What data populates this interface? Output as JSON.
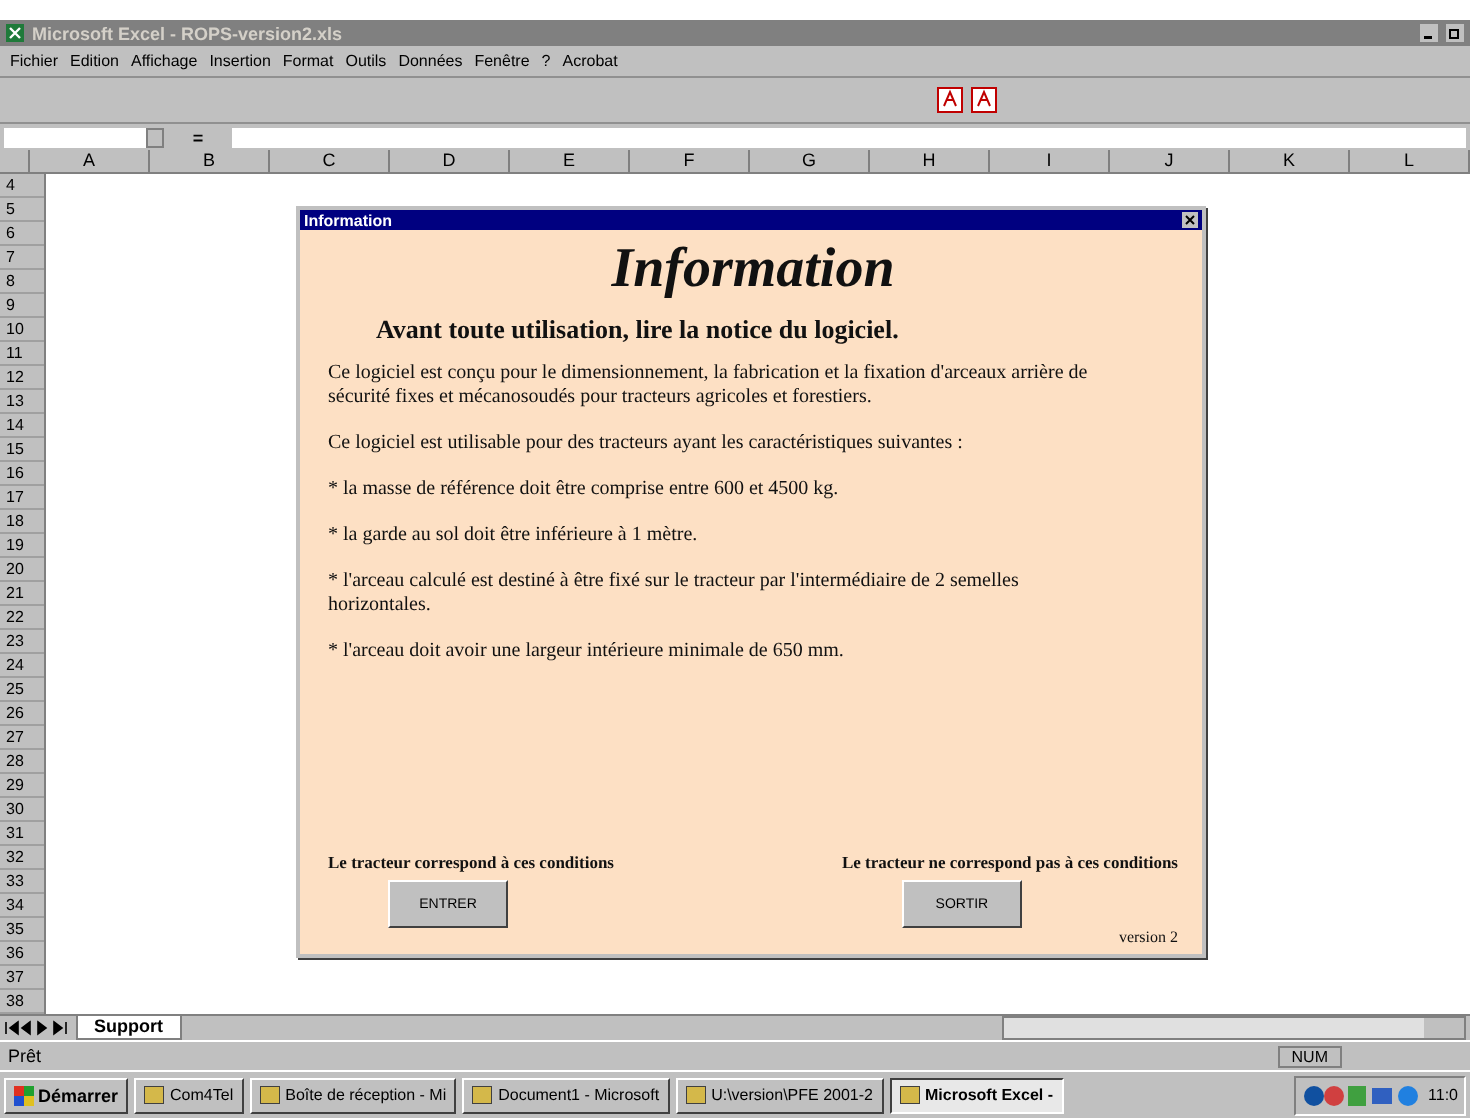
{
  "window": {
    "title": "Microsoft Excel - ROPS-version2.xls"
  },
  "menu": [
    "Fichier",
    "Edition",
    "Affichage",
    "Insertion",
    "Format",
    "Outils",
    "Données",
    "Fenêtre",
    "?",
    "Acrobat"
  ],
  "formula_bar": {
    "equals": "="
  },
  "columns": [
    "A",
    "B",
    "C",
    "D",
    "E",
    "F",
    "G",
    "H",
    "I",
    "J",
    "K",
    "L"
  ],
  "rows": [
    "4",
    "5",
    "6",
    "7",
    "8",
    "9",
    "10",
    "11",
    "12",
    "13",
    "14",
    "15",
    "16",
    "17",
    "18",
    "19",
    "20",
    "21",
    "22",
    "23",
    "24",
    "25",
    "26",
    "27",
    "28",
    "29",
    "30",
    "31",
    "32",
    "33",
    "34",
    "35",
    "36",
    "37",
    "38"
  ],
  "dialog": {
    "title": "Information",
    "heading": "Information",
    "subheading": "Avant toute utilisation, lire la notice du logiciel.",
    "paragraphs": [
      "Ce logiciel est conçu pour le dimensionnement, la fabrication et la fixation d'arceaux arrière de sécurité fixes et mécanosoudés pour tracteurs agricoles et forestiers.",
      "Ce logiciel est utilisable pour des tracteurs ayant les caractéristiques suivantes :",
      "* la masse de référence doit être comprise entre 600 et 4500 kg.",
      "* la garde au sol doit être inférieure à 1 mètre.",
      "* l'arceau calculé est destiné à être fixé sur le tracteur par l'intermédiaire de 2 semelles horizontales.",
      "* l'arceau doit avoir une largeur intérieure minimale de 650 mm."
    ],
    "actions": [
      {
        "caption": "Le tracteur correspond à ces conditions",
        "button": "ENTRER"
      },
      {
        "caption": "Le tracteur ne correspond pas à ces conditions",
        "button": "SORTIR"
      }
    ],
    "version": "version 2"
  },
  "sheet_tabs": [
    {
      "label": "Support",
      "selected": true
    }
  ],
  "status_bar": {
    "text": "Prêt",
    "indicator": "NUM"
  },
  "taskbar": {
    "start": "Démarrer",
    "items": [
      {
        "label": "Com4Tel",
        "selected": false
      },
      {
        "label": "Boîte de réception - Mi",
        "selected": false
      },
      {
        "label": "Document1 - Microsoft",
        "selected": false
      },
      {
        "label": "U:\\version\\PFE 2001-2",
        "selected": false
      },
      {
        "label": "Microsoft Excel -",
        "selected": true
      }
    ],
    "clock": "11:0"
  }
}
